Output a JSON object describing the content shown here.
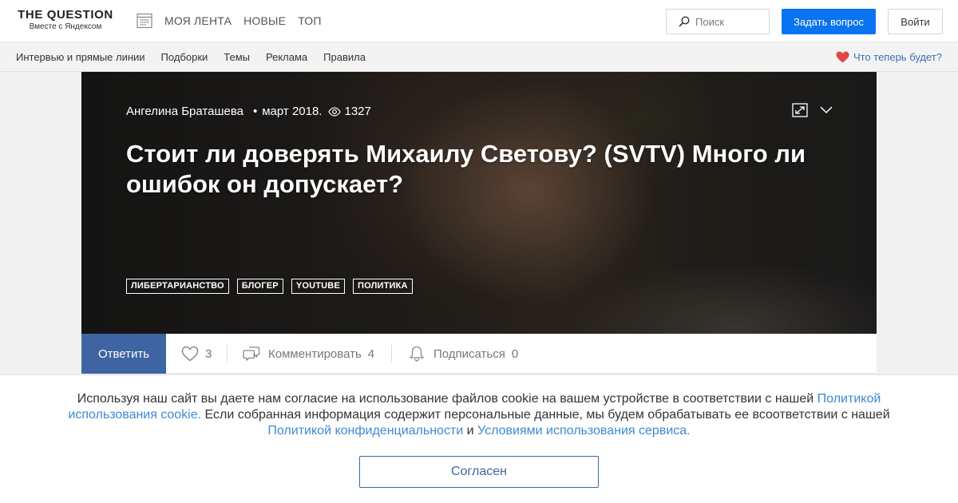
{
  "header": {
    "logo_title": "THE QUESTION",
    "logo_subtitle": "Вместе с Яндексом",
    "nav": [
      "МОЯ ЛЕНТА",
      "НОВЫЕ",
      "ТОП"
    ],
    "search_placeholder": "Поиск",
    "ask_button": "Задать вопрос",
    "login_button": "Войти",
    "icons": {
      "feed": "feed-icon",
      "search": "search-icon"
    }
  },
  "subnav": {
    "items": [
      "Интервью и прямые линии",
      "Подборки",
      "Темы",
      "Реклама",
      "Правила"
    ],
    "promo_text": "Что теперь будет?",
    "promo_icon": "heart-icon",
    "promo_color": "#e04848"
  },
  "question": {
    "author": "Ангелина Браташева",
    "separator": "•",
    "date": "март 2018.",
    "views": "1327",
    "title": "Стоит ли доверять Михаилу Светову? (SVTV) Много ли ошибок он допускает?",
    "tags": [
      "ЛИБЕРТАРИАНСТВО",
      "БЛОГЕР",
      "YOUTUBE",
      "ПОЛИТИКА"
    ],
    "icons": {
      "views": "eye-icon",
      "expand": "expand-icon",
      "more": "chevron-down-icon"
    }
  },
  "actions": {
    "answer_button": "Ответить",
    "likes": "3",
    "comment_label": "Комментировать",
    "comments": "4",
    "subscribe_label": "Подписаться",
    "subscribers": "0"
  },
  "cookie": {
    "text_1": "Используя наш сайт вы даете нам согласие на использование файлов cookie на вашем устройстве в соответствии с нашей ",
    "link_1": "Политикой использования cookie.",
    "text_2": " Если собранная информация содержит персональные данные, мы будем обрабатывать ее всоответствии с нашей ",
    "link_2": "Политикой конфиденциальности",
    "text_3": " и ",
    "link_3": "Условиями использования сервиса.",
    "agree_button": "Согласен"
  },
  "colors": {
    "primary_blue": "#0a74f0",
    "answer_blue": "#3e64a3",
    "link_blue": "#3c8bd4"
  }
}
